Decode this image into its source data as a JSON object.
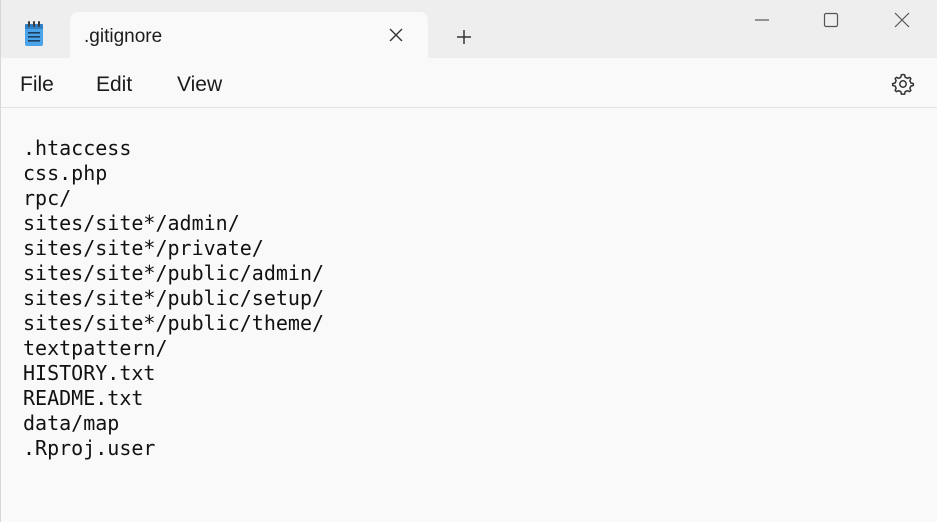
{
  "window": {
    "tab_title": ".gitignore",
    "app_icon": "notepad-icon",
    "tab_close_icon": "close-icon",
    "new_tab_icon": "plus-icon",
    "minimize_icon": "minimize-icon",
    "maximize_icon": "maximize-icon",
    "close_icon": "close-icon"
  },
  "menu": {
    "file": "File",
    "edit": "Edit",
    "view": "View",
    "settings_icon": "gear-icon"
  },
  "editor": {
    "lines": [
      ".htaccess",
      "css.php",
      "rpc/",
      "sites/site*/admin/",
      "sites/site*/private/",
      "sites/site*/public/admin/",
      "sites/site*/public/setup/",
      "sites/site*/public/theme/",
      "textpattern/",
      "HISTORY.txt",
      "README.txt",
      "data/map",
      ".Rproj.user"
    ]
  },
  "colors": {
    "titlebar_bg": "#eeeeee",
    "content_bg": "#f9f9f9",
    "text": "#1b1b1b",
    "icon_blue": "#3a8fd6"
  }
}
